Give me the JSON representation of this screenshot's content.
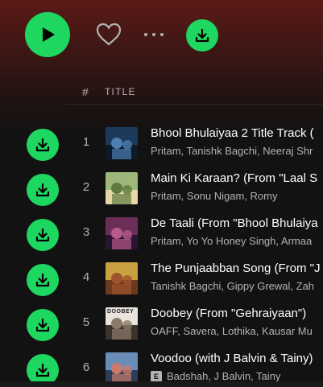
{
  "header": {
    "num_label": "#",
    "title_label": "TITLE"
  },
  "colors": {
    "accent": "#1ed760",
    "background": "#121212",
    "header_gradient_top": "#5a1a17",
    "secondary_text": "#b3b3b3"
  },
  "icons": {
    "play": "play-icon",
    "like": "heart-icon",
    "more": "more-icon",
    "download": "download-icon",
    "explicit": "explicit-icon"
  },
  "tracks": [
    {
      "num": "1",
      "title": "Bhool Bhulaiyaa 2 Title Track (",
      "artists": "Pritam, Tanishk Bagchi, Neeraj Shr",
      "explicit": false
    },
    {
      "num": "2",
      "title": "Main Ki Karaan? (From \"Laal S",
      "artists": "Pritam, Sonu Nigam, Romy",
      "explicit": false
    },
    {
      "num": "3",
      "title": "De Taali (From \"Bhool Bhulaiya",
      "artists": "Pritam, Yo Yo Honey Singh, Armaa",
      "explicit": false
    },
    {
      "num": "4",
      "title": "The Punjaabban Song (From \"J",
      "artists": "Tanishk Bagchi, Gippy Grewal, Zah",
      "explicit": false
    },
    {
      "num": "5",
      "title": "Doobey (From \"Gehraiyaan\")",
      "artists": "OAFF, Savera, Lothika, Kausar Mu",
      "explicit": false
    },
    {
      "num": "6",
      "title": "Voodoo (with J Balvin & Tainy)",
      "artists": "Badshah, J Balvin, Tainy",
      "explicit": true,
      "explicit_label": "E"
    }
  ],
  "thumbs": [
    {
      "colors": [
        "#1b3a5c",
        "#4d7fb0",
        "#0d1a2a"
      ]
    },
    {
      "colors": [
        "#9db87a",
        "#5c7a3e",
        "#e6d7a8"
      ]
    },
    {
      "colors": [
        "#6b2f57",
        "#b85a8a",
        "#2a1530"
      ]
    },
    {
      "colors": [
        "#c9a23f",
        "#a0522d",
        "#6b3a1e"
      ]
    },
    {
      "colors": [
        "#e8e4dc",
        "#8a7b6a",
        "#3a342c"
      ],
      "label": "DOOBEY"
    },
    {
      "colors": [
        "#6a8db8",
        "#c97a6a",
        "#2c3d5a"
      ]
    }
  ]
}
